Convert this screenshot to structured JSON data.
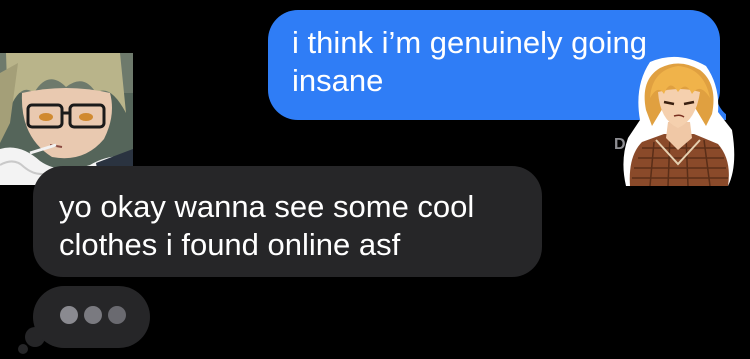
{
  "conversation": {
    "sent_message": {
      "line1": "i think i’m genuinely going",
      "line2": "insane"
    },
    "delivered_partial": "D",
    "received_message": {
      "line1": "yo okay wanna see some cool",
      "line2": "clothes i found online asf"
    }
  },
  "colors": {
    "background": "#000000",
    "sent_bubble": "#2f7df6",
    "received_bubble": "#262628",
    "status_text": "#8e8e93"
  },
  "icons": {
    "left_avatar": "anime-character-glasses-avatar",
    "right_sticker": "anime-character-blonde-sticker",
    "typing": "typing-indicator-dots"
  }
}
